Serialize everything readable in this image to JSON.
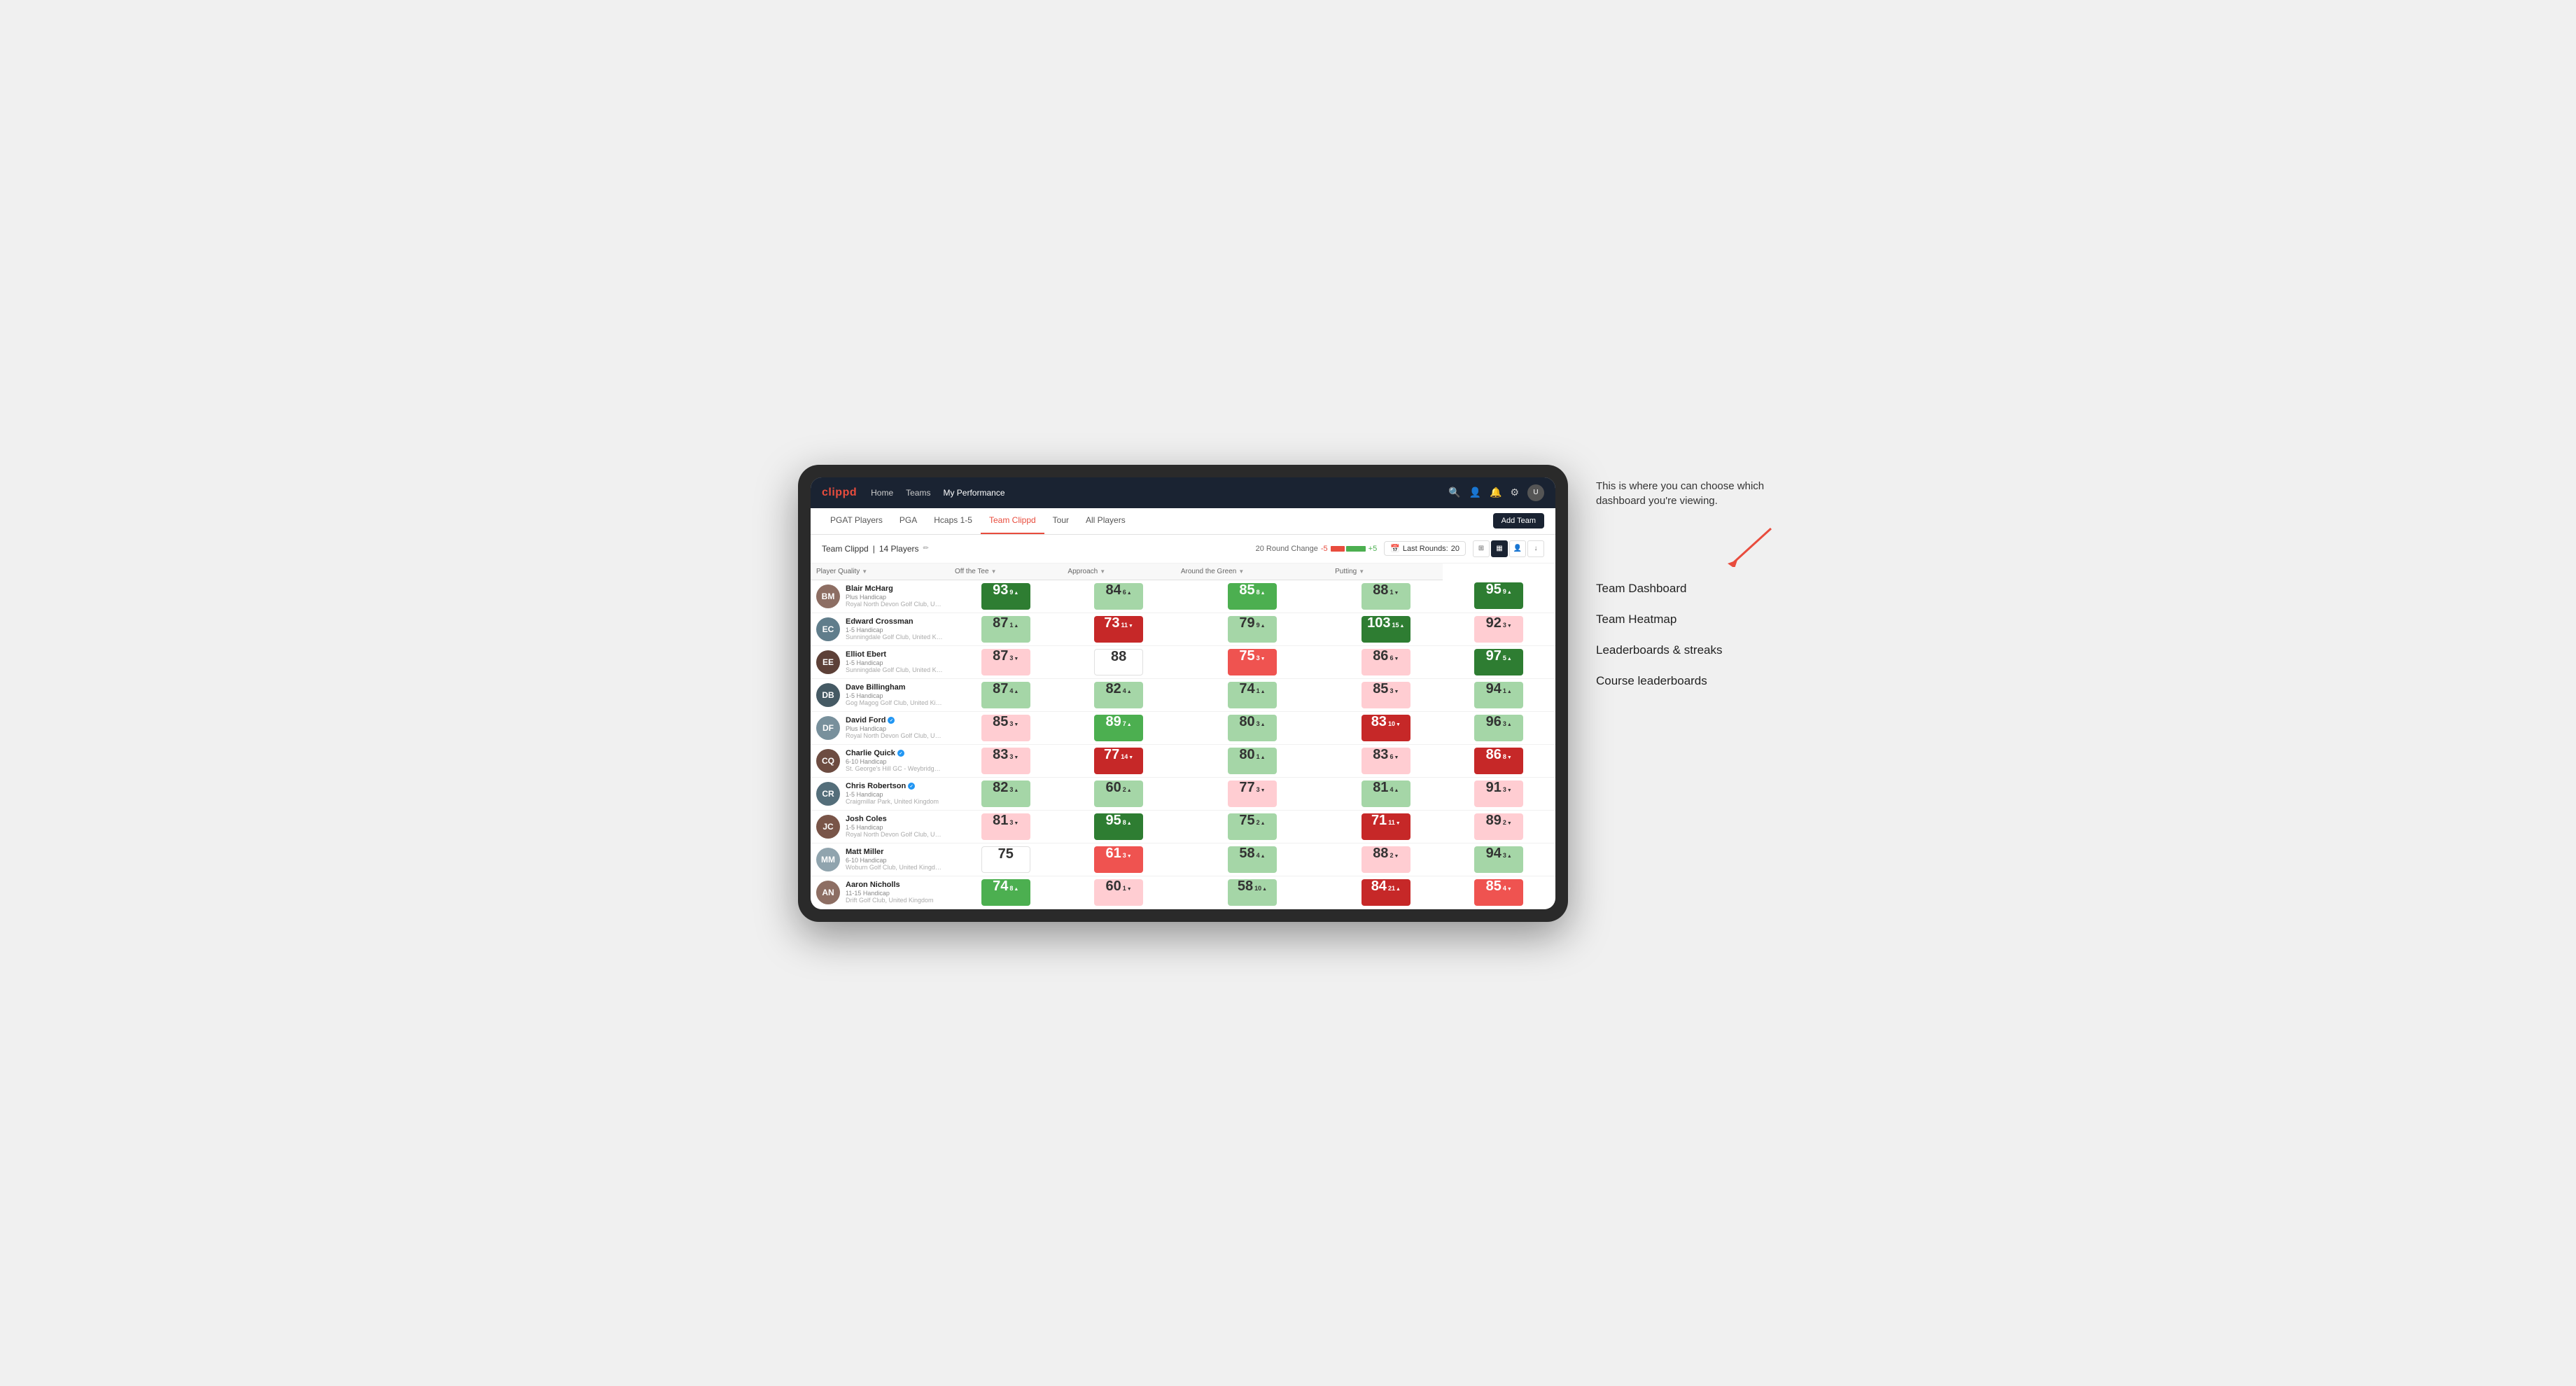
{
  "annotation": {
    "description": "This is where you can choose which dashboard you're viewing.",
    "arrow_direction": "↘"
  },
  "dashboard_options": [
    "Team Dashboard",
    "Team Heatmap",
    "Leaderboards & streaks",
    "Course leaderboards"
  ],
  "nav": {
    "logo": "clippd",
    "links": [
      "Home",
      "Teams",
      "My Performance"
    ],
    "active_link": "My Performance"
  },
  "sub_nav": {
    "items": [
      "PGAT Players",
      "PGA",
      "Hcaps 1-5",
      "Team Clippd",
      "Tour",
      "All Players"
    ],
    "active": "Team Clippd",
    "add_team_label": "Add Team"
  },
  "team_header": {
    "team_name": "Team Clippd",
    "player_count": "14 Players",
    "round_change_label": "20 Round Change",
    "neg_val": "-5",
    "pos_val": "+5",
    "last_rounds_label": "Last Rounds:",
    "last_rounds_val": "20"
  },
  "table": {
    "columns": [
      {
        "key": "player",
        "label": "Player Quality",
        "sortable": true
      },
      {
        "key": "off_tee",
        "label": "Off the Tee",
        "sortable": true
      },
      {
        "key": "approach",
        "label": "Approach",
        "sortable": true
      },
      {
        "key": "around_green",
        "label": "Around the Green",
        "sortable": true
      },
      {
        "key": "putting",
        "label": "Putting",
        "sortable": true
      }
    ],
    "rows": [
      {
        "name": "Blair McHarg",
        "handicap": "Plus Handicap",
        "club": "Royal North Devon Golf Club, United Kingdom",
        "initials": "BM",
        "avatar_color": "#8d6e63",
        "verified": false,
        "scores": [
          {
            "val": "93",
            "change": "9",
            "dir": "up",
            "color": "green-dark"
          },
          {
            "val": "84",
            "change": "6",
            "dir": "up",
            "color": "green-light"
          },
          {
            "val": "85",
            "change": "8",
            "dir": "up",
            "color": "green-mid"
          },
          {
            "val": "88",
            "change": "1",
            "dir": "down",
            "color": "green-light"
          },
          {
            "val": "95",
            "change": "9",
            "dir": "up",
            "color": "green-dark"
          }
        ]
      },
      {
        "name": "Edward Crossman",
        "handicap": "1-5 Handicap",
        "club": "Sunningdale Golf Club, United Kingdom",
        "initials": "EC",
        "avatar_color": "#607d8b",
        "verified": false,
        "scores": [
          {
            "val": "87",
            "change": "1",
            "dir": "up",
            "color": "green-light"
          },
          {
            "val": "73",
            "change": "11",
            "dir": "down",
            "color": "red-dark"
          },
          {
            "val": "79",
            "change": "9",
            "dir": "up",
            "color": "green-light"
          },
          {
            "val": "103",
            "change": "15",
            "dir": "up",
            "color": "green-dark"
          },
          {
            "val": "92",
            "change": "3",
            "dir": "down",
            "color": "red-light"
          }
        ]
      },
      {
        "name": "Elliot Ebert",
        "handicap": "1-5 Handicap",
        "club": "Sunningdale Golf Club, United Kingdom",
        "initials": "EE",
        "avatar_color": "#5d4037",
        "verified": false,
        "scores": [
          {
            "val": "87",
            "change": "3",
            "dir": "down",
            "color": "red-light"
          },
          {
            "val": "88",
            "change": "",
            "dir": "none",
            "color": "neutral"
          },
          {
            "val": "75",
            "change": "3",
            "dir": "down",
            "color": "red-mid"
          },
          {
            "val": "86",
            "change": "6",
            "dir": "down",
            "color": "red-light"
          },
          {
            "val": "97",
            "change": "5",
            "dir": "up",
            "color": "green-dark"
          }
        ]
      },
      {
        "name": "Dave Billingham",
        "handicap": "1-5 Handicap",
        "club": "Gog Magog Golf Club, United Kingdom",
        "initials": "DB",
        "avatar_color": "#455a64",
        "verified": false,
        "scores": [
          {
            "val": "87",
            "change": "4",
            "dir": "up",
            "color": "green-light"
          },
          {
            "val": "82",
            "change": "4",
            "dir": "up",
            "color": "green-light"
          },
          {
            "val": "74",
            "change": "1",
            "dir": "up",
            "color": "green-light"
          },
          {
            "val": "85",
            "change": "3",
            "dir": "down",
            "color": "red-light"
          },
          {
            "val": "94",
            "change": "1",
            "dir": "up",
            "color": "green-light"
          }
        ]
      },
      {
        "name": "David Ford",
        "handicap": "Plus Handicap",
        "club": "Royal North Devon Golf Club, United Kingdom",
        "initials": "DF",
        "avatar_color": "#78909c",
        "verified": true,
        "scores": [
          {
            "val": "85",
            "change": "3",
            "dir": "down",
            "color": "red-light"
          },
          {
            "val": "89",
            "change": "7",
            "dir": "up",
            "color": "green-mid"
          },
          {
            "val": "80",
            "change": "3",
            "dir": "up",
            "color": "green-light"
          },
          {
            "val": "83",
            "change": "10",
            "dir": "down",
            "color": "red-dark"
          },
          {
            "val": "96",
            "change": "3",
            "dir": "up",
            "color": "green-light"
          }
        ]
      },
      {
        "name": "Charlie Quick",
        "handicap": "6-10 Handicap",
        "club": "St. George's Hill GC - Weybridge - Surrey, Uni...",
        "initials": "CQ",
        "avatar_color": "#6d4c41",
        "verified": true,
        "scores": [
          {
            "val": "83",
            "change": "3",
            "dir": "down",
            "color": "red-light"
          },
          {
            "val": "77",
            "change": "14",
            "dir": "down",
            "color": "red-dark"
          },
          {
            "val": "80",
            "change": "1",
            "dir": "up",
            "color": "green-light"
          },
          {
            "val": "83",
            "change": "6",
            "dir": "down",
            "color": "red-light"
          },
          {
            "val": "86",
            "change": "8",
            "dir": "down",
            "color": "red-dark"
          }
        ]
      },
      {
        "name": "Chris Robertson",
        "handicap": "1-5 Handicap",
        "club": "Craigmillar Park, United Kingdom",
        "initials": "CR",
        "avatar_color": "#546e7a",
        "verified": true,
        "scores": [
          {
            "val": "82",
            "change": "3",
            "dir": "up",
            "color": "green-light"
          },
          {
            "val": "60",
            "change": "2",
            "dir": "up",
            "color": "green-light"
          },
          {
            "val": "77",
            "change": "3",
            "dir": "down",
            "color": "red-light"
          },
          {
            "val": "81",
            "change": "4",
            "dir": "up",
            "color": "green-light"
          },
          {
            "val": "91",
            "change": "3",
            "dir": "down",
            "color": "red-light"
          }
        ]
      },
      {
        "name": "Josh Coles",
        "handicap": "1-5 Handicap",
        "club": "Royal North Devon Golf Club, United Kingdom",
        "initials": "JC",
        "avatar_color": "#795548",
        "verified": false,
        "scores": [
          {
            "val": "81",
            "change": "3",
            "dir": "down",
            "color": "red-light"
          },
          {
            "val": "95",
            "change": "8",
            "dir": "up",
            "color": "green-dark"
          },
          {
            "val": "75",
            "change": "2",
            "dir": "up",
            "color": "green-light"
          },
          {
            "val": "71",
            "change": "11",
            "dir": "down",
            "color": "red-dark"
          },
          {
            "val": "89",
            "change": "2",
            "dir": "down",
            "color": "red-light"
          }
        ]
      },
      {
        "name": "Matt Miller",
        "handicap": "6-10 Handicap",
        "club": "Woburn Golf Club, United Kingdom",
        "initials": "MM",
        "avatar_color": "#90a4ae",
        "verified": false,
        "scores": [
          {
            "val": "75",
            "change": "",
            "dir": "none",
            "color": "neutral"
          },
          {
            "val": "61",
            "change": "3",
            "dir": "down",
            "color": "red-mid"
          },
          {
            "val": "58",
            "change": "4",
            "dir": "up",
            "color": "green-light"
          },
          {
            "val": "88",
            "change": "2",
            "dir": "down",
            "color": "red-light"
          },
          {
            "val": "94",
            "change": "3",
            "dir": "up",
            "color": "green-light"
          }
        ]
      },
      {
        "name": "Aaron Nicholls",
        "handicap": "11-15 Handicap",
        "club": "Drift Golf Club, United Kingdom",
        "initials": "AN",
        "avatar_color": "#8d6e63",
        "verified": false,
        "scores": [
          {
            "val": "74",
            "change": "8",
            "dir": "up",
            "color": "green-mid"
          },
          {
            "val": "60",
            "change": "1",
            "dir": "down",
            "color": "red-light"
          },
          {
            "val": "58",
            "change": "10",
            "dir": "up",
            "color": "green-light"
          },
          {
            "val": "84",
            "change": "21",
            "dir": "up",
            "color": "red-dark"
          },
          {
            "val": "85",
            "change": "4",
            "dir": "down",
            "color": "red-mid"
          }
        ]
      }
    ]
  }
}
